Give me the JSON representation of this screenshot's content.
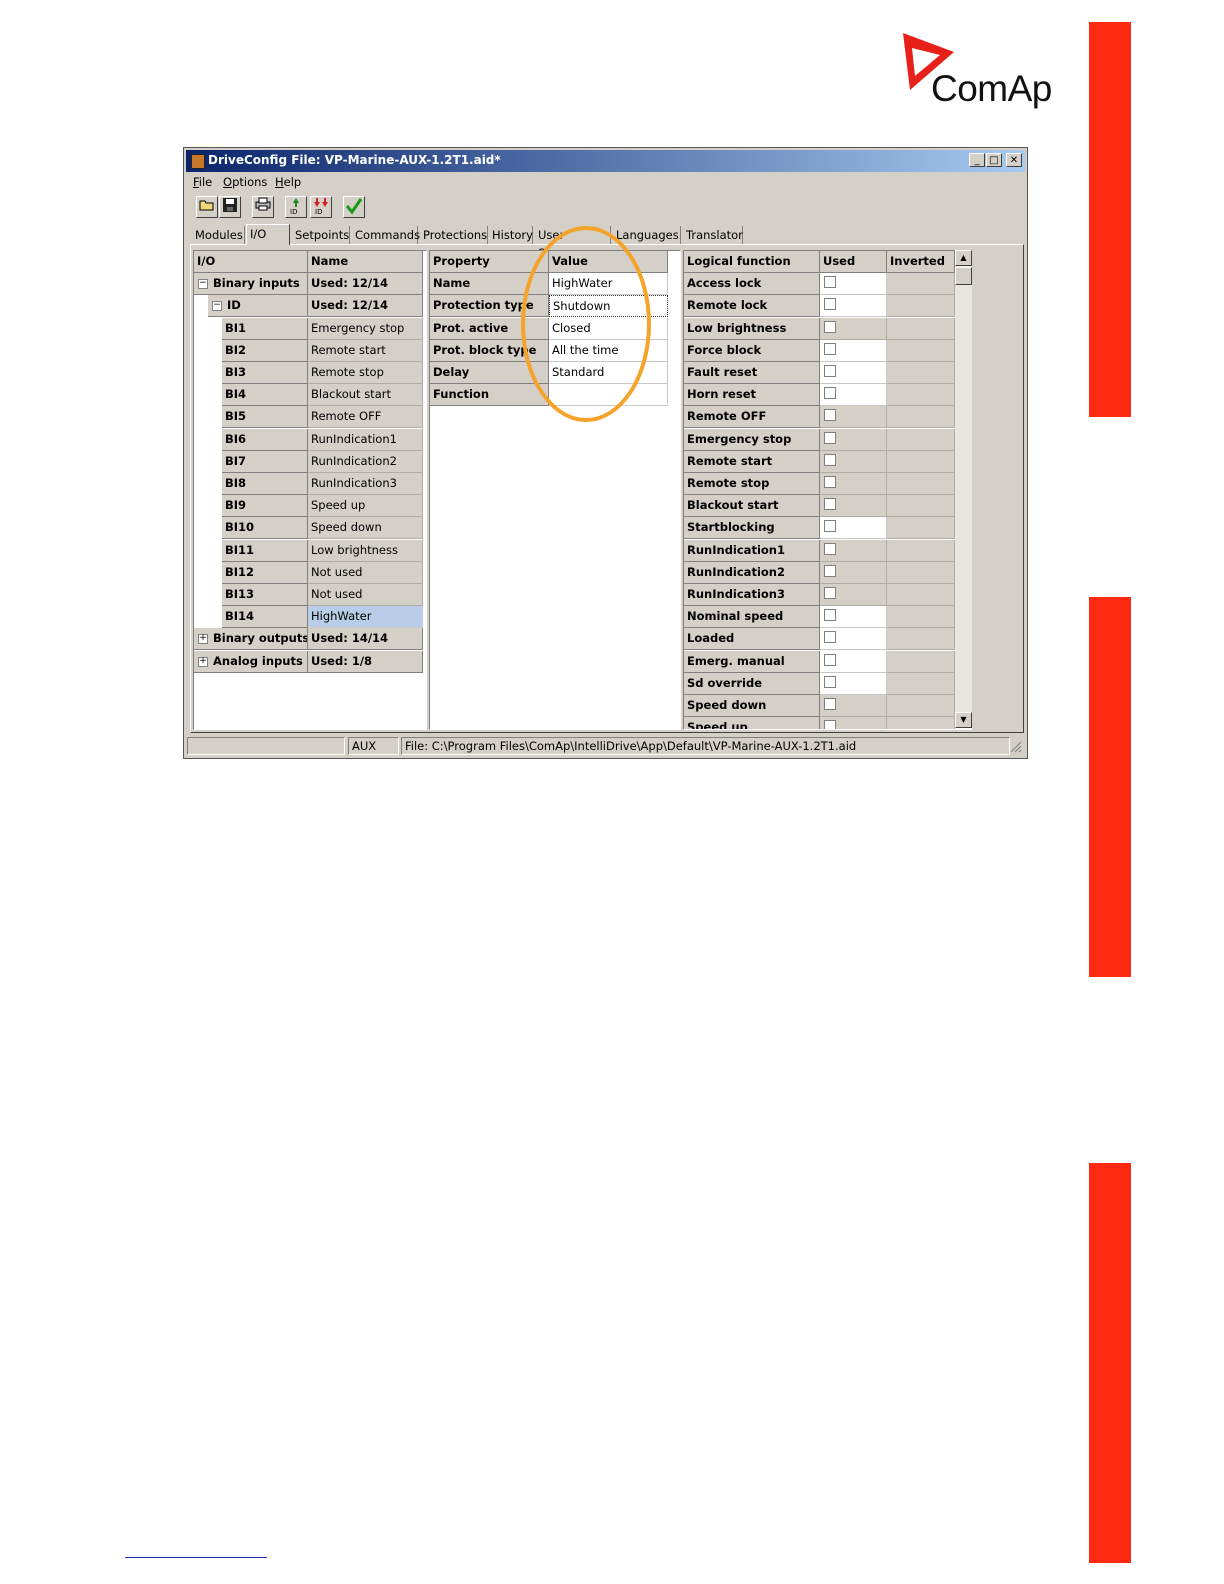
{
  "brand": {
    "logo_text": "ComAp",
    "accent_color": "#ff2a12",
    "logo_color": "#e8201a"
  },
  "window": {
    "title": "DriveConfig File: VP-Marine-AUX-1.2T1.aid*",
    "minimize": "_",
    "maximize": "□",
    "close": "✕"
  },
  "menu": [
    {
      "label": "File",
      "key": "F",
      "rest": "ile"
    },
    {
      "label": "Options",
      "key": "O",
      "rest": "ptions"
    },
    {
      "label": "Help",
      "key": "H",
      "rest": "elp"
    }
  ],
  "toolbar": [
    "open-icon",
    "save-icon",
    "print-icon",
    "import-id-icon",
    "export-id-icon",
    "check-icon"
  ],
  "tabs": [
    "Modules",
    "I/O",
    "Setpoints",
    "Commands",
    "Protections",
    "History",
    "User Sensors",
    "Languages",
    "Translator"
  ],
  "active_tab": "I/O",
  "io_grid": {
    "headers": [
      "I/O",
      "Name"
    ],
    "rows": [
      {
        "io": "Binary inputs",
        "name": "Used: 12/14",
        "level": 0,
        "expander": "−",
        "bold_name": true
      },
      {
        "io": "ID",
        "name": "Used: 12/14",
        "level": 1,
        "expander": "−",
        "bold_name": true
      },
      {
        "io": "BI1",
        "name": "Emergency stop",
        "level": 2
      },
      {
        "io": "BI2",
        "name": "Remote start",
        "level": 2
      },
      {
        "io": "BI3",
        "name": "Remote stop",
        "level": 2
      },
      {
        "io": "BI4",
        "name": "Blackout start",
        "level": 2
      },
      {
        "io": "BI5",
        "name": "Remote OFF",
        "level": 2
      },
      {
        "io": "BI6",
        "name": "RunIndication1",
        "level": 2
      },
      {
        "io": "BI7",
        "name": "RunIndication2",
        "level": 2
      },
      {
        "io": "BI8",
        "name": "RunIndication3",
        "level": 2
      },
      {
        "io": "BI9",
        "name": "Speed up",
        "level": 2
      },
      {
        "io": "BI10",
        "name": "Speed down",
        "level": 2
      },
      {
        "io": "BI11",
        "name": "Low brightness",
        "level": 2
      },
      {
        "io": "BI12",
        "name": "Not used",
        "level": 2
      },
      {
        "io": "BI13",
        "name": "Not used",
        "level": 2
      },
      {
        "io": "BI14",
        "name": "HighWater",
        "level": 2,
        "selected": true
      },
      {
        "io": "Binary outputs",
        "name": "Used: 14/14",
        "level": 0,
        "expander": "+",
        "bold_name": true
      },
      {
        "io": "Analog inputs",
        "name": "Used: 1/8",
        "level": 0,
        "expander": "+",
        "bold_name": true
      }
    ]
  },
  "property_grid": {
    "headers": [
      "Property",
      "Value"
    ],
    "rows": [
      {
        "property": "Name",
        "value": "HighWater"
      },
      {
        "property": "Protection type",
        "value": "Shutdown"
      },
      {
        "property": "Prot. active",
        "value": "Closed"
      },
      {
        "property": "Prot. block type",
        "value": "All the time"
      },
      {
        "property": "Delay",
        "value": "Standard"
      },
      {
        "property": "Function",
        "value": ""
      }
    ]
  },
  "function_grid": {
    "headers": [
      "Logical function",
      "Used",
      "Inverted"
    ],
    "rows": [
      {
        "name": "Access lock",
        "used": false,
        "used_white": true
      },
      {
        "name": "Remote lock",
        "used": false,
        "used_white": true
      },
      {
        "name": "Low brightness",
        "used": false,
        "used_white": false
      },
      {
        "name": "Force block",
        "used": false,
        "used_white": true
      },
      {
        "name": "Fault reset",
        "used": false,
        "used_white": true
      },
      {
        "name": "Horn reset",
        "used": false,
        "used_white": true
      },
      {
        "name": "Remote OFF",
        "used": false,
        "used_white": false
      },
      {
        "name": "Emergency stop",
        "used": false,
        "used_white": false
      },
      {
        "name": "Remote start",
        "used": false,
        "used_white": false
      },
      {
        "name": "Remote stop",
        "used": false,
        "used_white": false
      },
      {
        "name": "Blackout start",
        "used": false,
        "used_white": false
      },
      {
        "name": "Startblocking",
        "used": false,
        "used_white": true
      },
      {
        "name": "RunIndication1",
        "used": false,
        "used_white": false
      },
      {
        "name": "RunIndication2",
        "used": false,
        "used_white": false
      },
      {
        "name": "RunIndication3",
        "used": false,
        "used_white": false
      },
      {
        "name": "Nominal speed",
        "used": false,
        "used_white": true
      },
      {
        "name": "Loaded",
        "used": false,
        "used_white": true
      },
      {
        "name": "Emerg. manual",
        "used": false,
        "used_white": true
      },
      {
        "name": "Sd override",
        "used": false,
        "used_white": true
      },
      {
        "name": "Speed down",
        "used": false,
        "used_white": false
      },
      {
        "name": "Speed up",
        "used": false,
        "used_white": false
      }
    ]
  },
  "scrollbar": {
    "up": "▲",
    "down": "▼"
  },
  "status": {
    "panel1": "",
    "mode": "AUX",
    "file": "File: C:\\Program Files\\ComAp\\IntelliDrive\\App\\Default\\VP-Marine-AUX-1.2T1.aid"
  }
}
